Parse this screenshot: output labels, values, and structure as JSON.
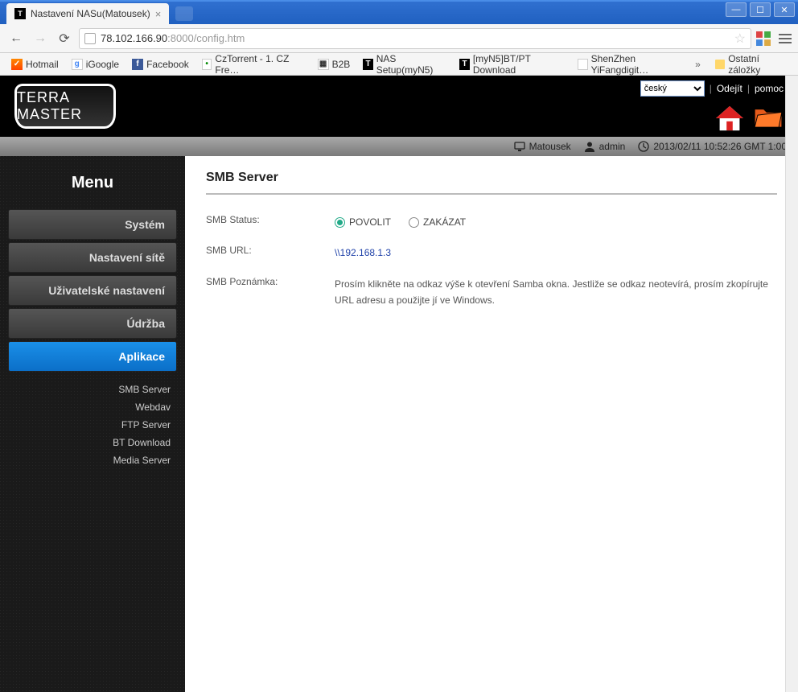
{
  "browser": {
    "tab_title": "Nastavení NASu(Matousek)",
    "url_host": "78.102.166.90",
    "url_port": ":8000",
    "url_path": "/config.htm"
  },
  "bookmarks": [
    {
      "label": "Hotmail",
      "icon": "hotmail"
    },
    {
      "label": "iGoogle",
      "icon": "google"
    },
    {
      "label": "Facebook",
      "icon": "fb"
    },
    {
      "label": "CzTorrent - 1. CZ Fre…",
      "icon": "cz"
    },
    {
      "label": "B2B",
      "icon": "b2b"
    },
    {
      "label": "NAS Setup(myN5)",
      "icon": "nas"
    },
    {
      "label": "[myN5]BT/PT Download",
      "icon": "nas"
    },
    {
      "label": "ShenZhen YiFangdigit…",
      "icon": "shen"
    }
  ],
  "bookmarks_other": "Ostatní záložky",
  "header": {
    "logo": "TERRA MASTER",
    "language": "český",
    "logout": "Odejít",
    "help": "pomoc"
  },
  "status": {
    "host": "Matousek",
    "user": "admin",
    "datetime": "2013/02/11 10:52:26 GMT 1:00"
  },
  "sidebar": {
    "title": "Menu",
    "items": [
      {
        "label": "Systém"
      },
      {
        "label": "Nastavení sítě"
      },
      {
        "label": "Uživatelské nastavení"
      },
      {
        "label": "Údržba"
      },
      {
        "label": "Aplikace",
        "active": true
      }
    ],
    "submenu": [
      "SMB Server",
      "Webdav",
      "FTP Server",
      "BT Download",
      "Media Server"
    ]
  },
  "content": {
    "title": "SMB Server",
    "status_label": "SMB Status:",
    "enable": "POVOLIT",
    "disable": "ZAKÁZAT",
    "url_label": "SMB URL:",
    "url_value": "\\\\192.168.1.3",
    "note_label": "SMB Poznámka:",
    "note_value": "Prosím klikněte na odkaz výše k otevření Samba okna. Jestliže se odkaz neotevírá, prosím zkopírujte URL adresu a použijte jí ve Windows."
  }
}
